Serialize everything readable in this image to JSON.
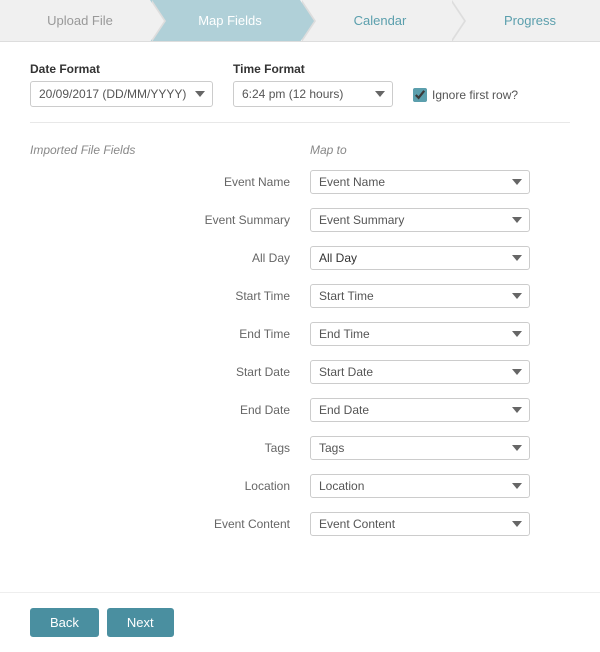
{
  "stepper": {
    "steps": [
      {
        "id": "upload",
        "label": "Upload File",
        "state": "completed"
      },
      {
        "id": "map",
        "label": "Map Fields",
        "state": "active"
      },
      {
        "id": "calendar",
        "label": "Calendar",
        "state": "future"
      },
      {
        "id": "progress",
        "label": "Progress",
        "state": "future"
      }
    ]
  },
  "formats": {
    "date_label": "Date Format",
    "date_value": "20/09/2017 (DD/MM/YYYY)",
    "time_label": "Time Format",
    "time_value": "6:24 pm (12 hours)",
    "ignore_label": "Ignore first row?"
  },
  "mapping": {
    "imported_header": "Imported File Fields",
    "mapto_header": "Map to",
    "rows": [
      {
        "field": "Event Name",
        "map": "Event Name"
      },
      {
        "field": "Event Summary",
        "map": "Event Summary"
      },
      {
        "field": "All Day",
        "map": "All Day"
      },
      {
        "field": "Start Time",
        "map": "Start Time"
      },
      {
        "field": "End Time",
        "map": "End Time"
      },
      {
        "field": "Start Date",
        "map": "Start Date"
      },
      {
        "field": "End Date",
        "map": "End Date"
      },
      {
        "field": "Tags",
        "map": "Tags"
      },
      {
        "field": "Location",
        "map": "Location"
      },
      {
        "field": "Event Content",
        "map": "Event Content"
      }
    ]
  },
  "buttons": {
    "back": "Back",
    "next": "Next"
  }
}
